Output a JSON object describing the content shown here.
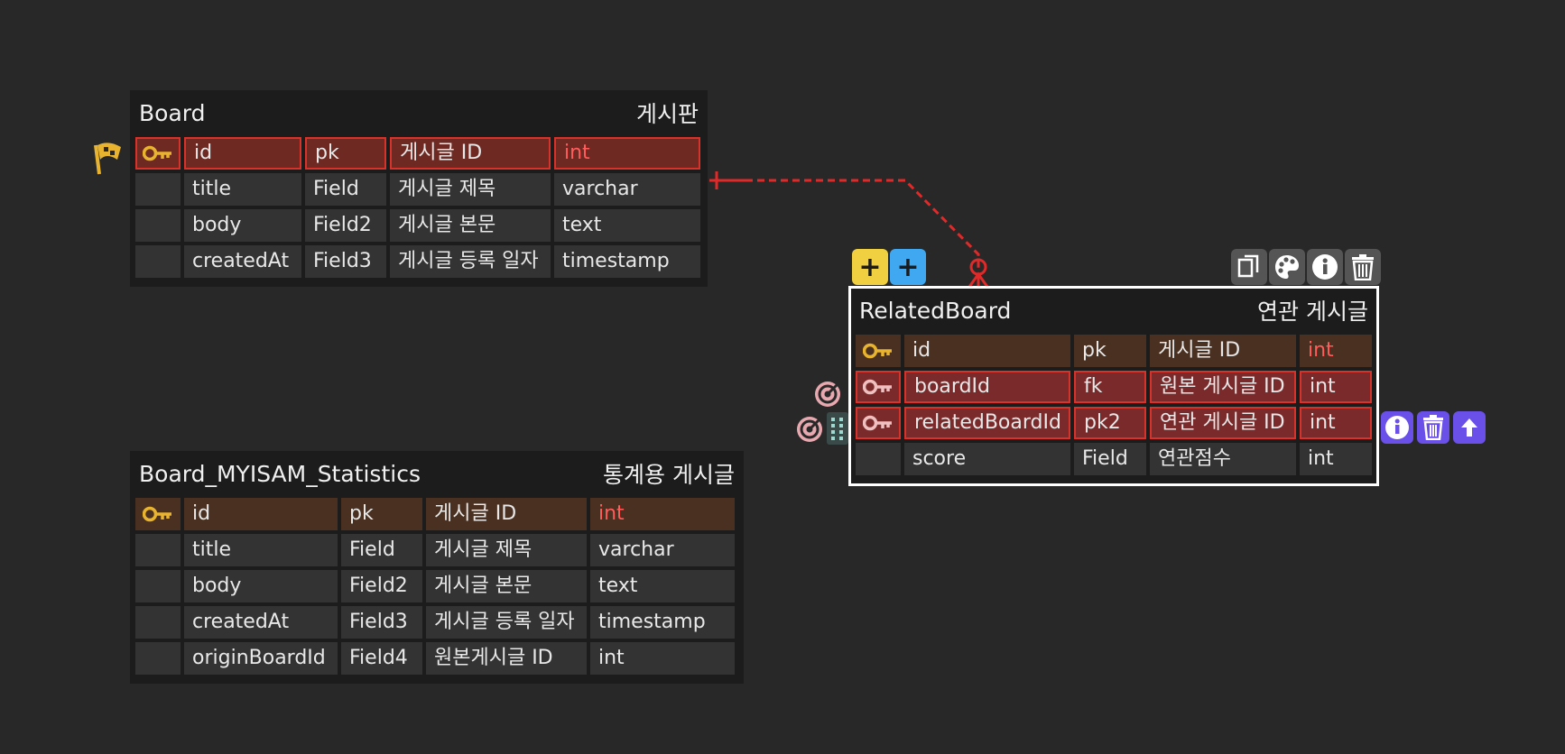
{
  "tables": {
    "board": {
      "name": "Board",
      "comment": "게시판",
      "rows": [
        {
          "name": "id",
          "key": "pk",
          "comment": "게시글 ID",
          "type": "int"
        },
        {
          "name": "title",
          "key": "Field",
          "comment": "게시글 제목",
          "type": "varchar"
        },
        {
          "name": "body",
          "key": "Field2",
          "comment": "게시글 본문",
          "type": "text"
        },
        {
          "name": "createdAt",
          "key": "Field3",
          "comment": "게시글 등록 일자",
          "type": "timestamp"
        }
      ]
    },
    "stats": {
      "name": "Board_MYISAM_Statistics",
      "comment": "통계용 게시글",
      "rows": [
        {
          "name": "id",
          "key": "pk",
          "comment": "게시글 ID",
          "type": "int"
        },
        {
          "name": "title",
          "key": "Field",
          "comment": "게시글 제목",
          "type": "varchar"
        },
        {
          "name": "body",
          "key": "Field2",
          "comment": "게시글 본문",
          "type": "text"
        },
        {
          "name": "createdAt",
          "key": "Field3",
          "comment": "게시글 등록 일자",
          "type": "timestamp"
        },
        {
          "name": "originBoardId",
          "key": "Field4",
          "comment": "원본게시글 ID",
          "type": "int"
        }
      ]
    },
    "related": {
      "name": "RelatedBoard",
      "comment": "연관 게시글",
      "rows": [
        {
          "name": "id",
          "key": "pk",
          "comment": "게시글 ID",
          "type": "int"
        },
        {
          "name": "boardId",
          "key": "fk",
          "comment": "원본 게시글 ID",
          "type": "int"
        },
        {
          "name": "relatedBoardId",
          "key": "pk2",
          "comment": "연관 게시글 ID",
          "type": "int"
        },
        {
          "name": "score",
          "key": "Field",
          "comment": "연관점수",
          "type": "int"
        }
      ]
    }
  },
  "toolbar": {
    "add_column": "+",
    "add_column_alt": "+"
  },
  "table_tools": [
    "copy-icon",
    "palette-icon",
    "info-icon",
    "trash-icon"
  ],
  "column_tools": [
    "info-icon",
    "trash-icon",
    "arrow-up-icon"
  ],
  "colors": {
    "background": "#282828",
    "table": "#1c1c1c",
    "cell": "#333333",
    "pk_row": "#4a3020",
    "highlight_border": "#d9322a",
    "relation_line": "#e02a2a",
    "key_icon": "#e8b430",
    "add_button_yellow": "#f0d040",
    "add_button_blue": "#40a8f0",
    "column_tool": "#6a50e8"
  }
}
